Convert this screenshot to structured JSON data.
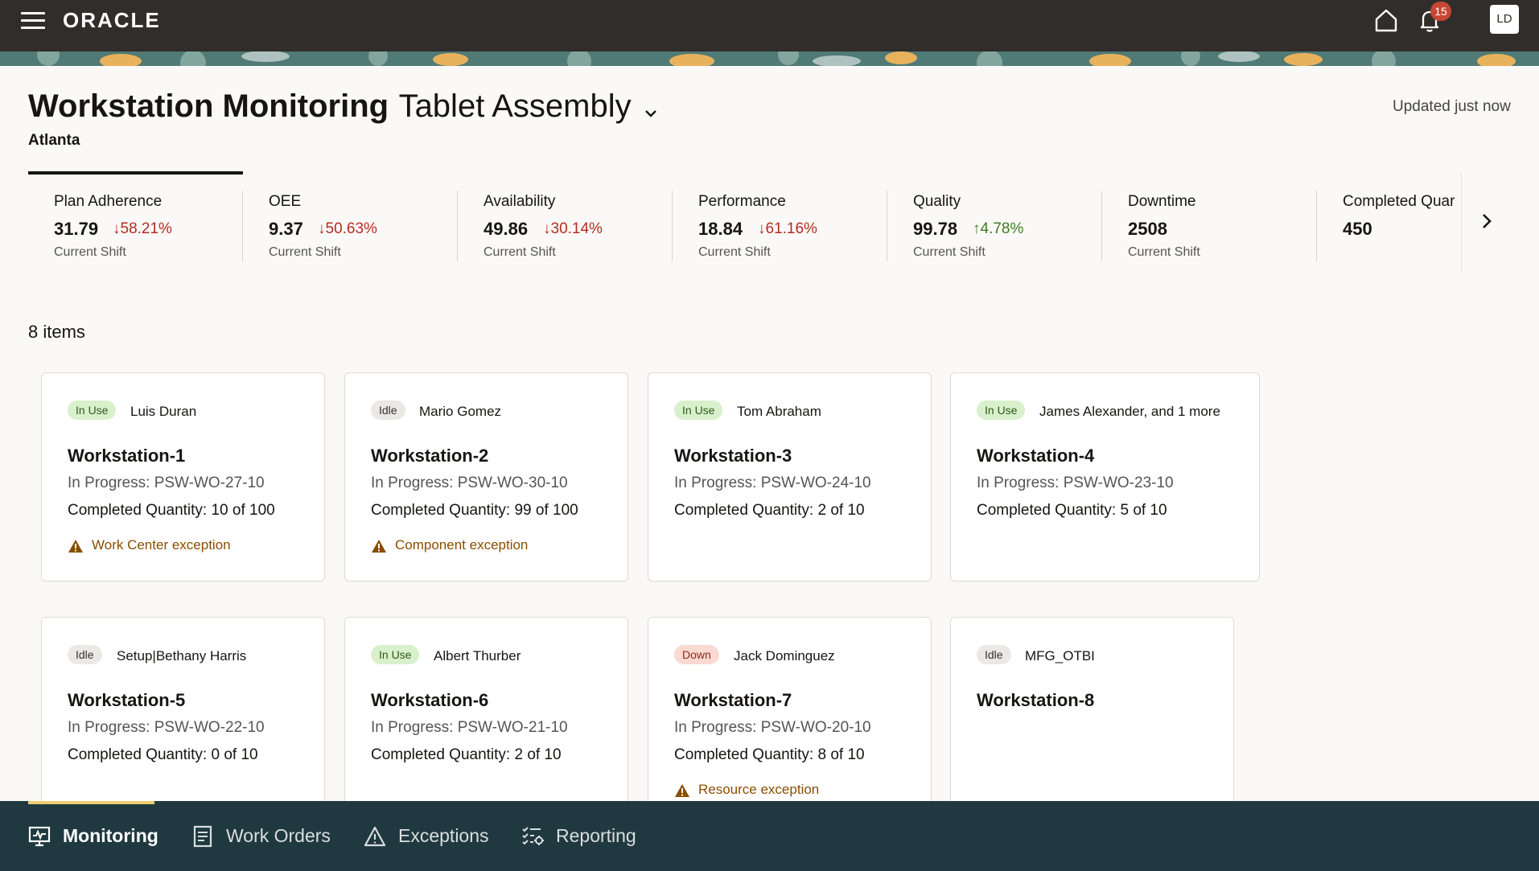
{
  "header": {
    "logo": "ORACLE",
    "notifications_count": "15",
    "avatar_initials": "LD"
  },
  "page": {
    "title": "Workstation Monitoring",
    "selector_value": "Tablet Assembly",
    "location": "Atlanta",
    "updated": "Updated just now",
    "items_count": "8 items"
  },
  "metrics": [
    {
      "label": "Plan Adherence",
      "value": "31.79",
      "change": "58.21%",
      "direction": "down",
      "sub": "Current Shift",
      "selected": true
    },
    {
      "label": "OEE",
      "value": "9.37",
      "change": "50.63%",
      "direction": "down",
      "sub": "Current Shift"
    },
    {
      "label": "Availability",
      "value": "49.86",
      "change": "30.14%",
      "direction": "down",
      "sub": "Current Shift"
    },
    {
      "label": "Performance",
      "value": "18.84",
      "change": "61.16%",
      "direction": "down",
      "sub": "Current Shift"
    },
    {
      "label": "Quality",
      "value": "99.78",
      "change": "4.78%",
      "direction": "up",
      "sub": "Current Shift"
    },
    {
      "label": "Downtime",
      "value": "2508",
      "change": "",
      "direction": "",
      "sub": "Current Shift"
    },
    {
      "label": "Completed Quar",
      "value": "450",
      "change": "",
      "direction": "",
      "sub": ""
    }
  ],
  "workstations": [
    {
      "status": "In Use",
      "operator": "Luis Duran",
      "name": "Workstation-1",
      "progress": "In Progress: PSW-WO-27-10",
      "quantity": "Completed Quantity: 10 of 100",
      "exception": "Work Center exception"
    },
    {
      "status": "Idle",
      "operator": "Mario Gomez",
      "name": "Workstation-2",
      "progress": "In Progress: PSW-WO-30-10",
      "quantity": "Completed Quantity: 99 of 100",
      "exception": "Component exception"
    },
    {
      "status": "In Use",
      "operator": "Tom Abraham",
      "name": "Workstation-3",
      "progress": "In Progress: PSW-WO-24-10",
      "quantity": "Completed Quantity: 2 of 10",
      "exception": ""
    },
    {
      "status": "In Use",
      "operator": "James Alexander, and 1 more",
      "name": "Workstation-4",
      "progress": "In Progress: PSW-WO-23-10",
      "quantity": "Completed Quantity: 5 of 10",
      "exception": ""
    },
    {
      "status": "Idle",
      "operator": "Setup|Bethany Harris",
      "name": "Workstation-5",
      "progress": "In Progress: PSW-WO-22-10",
      "quantity": "Completed Quantity: 0 of 10",
      "exception": ""
    },
    {
      "status": "In Use",
      "operator": "Albert Thurber",
      "name": "Workstation-6",
      "progress": "In Progress: PSW-WO-21-10",
      "quantity": "Completed Quantity: 2 of 10",
      "exception": ""
    },
    {
      "status": "Down",
      "operator": "Jack Dominguez",
      "name": "Workstation-7",
      "progress": "In Progress: PSW-WO-20-10",
      "quantity": "Completed Quantity: 8 of 10",
      "exception": "Resource exception"
    },
    {
      "status": "Idle",
      "operator": "MFG_OTBI",
      "name": "Workstation-8",
      "progress": "",
      "quantity": "",
      "exception": ""
    }
  ],
  "bottom_nav": [
    {
      "label": "Monitoring",
      "icon": "monitor-icon",
      "active": true
    },
    {
      "label": "Work Orders",
      "icon": "document-icon"
    },
    {
      "label": "Exceptions",
      "icon": "warning-icon"
    },
    {
      "label": "Reporting",
      "icon": "checklist-settings-icon"
    }
  ],
  "colors": {
    "header_bg": "#312d2a",
    "bottom_nav_bg": "#203940",
    "active_indicator": "#f0cc71",
    "negative": "#b32d1f",
    "positive": "#3f7b22",
    "exception": "#8a4d00"
  }
}
